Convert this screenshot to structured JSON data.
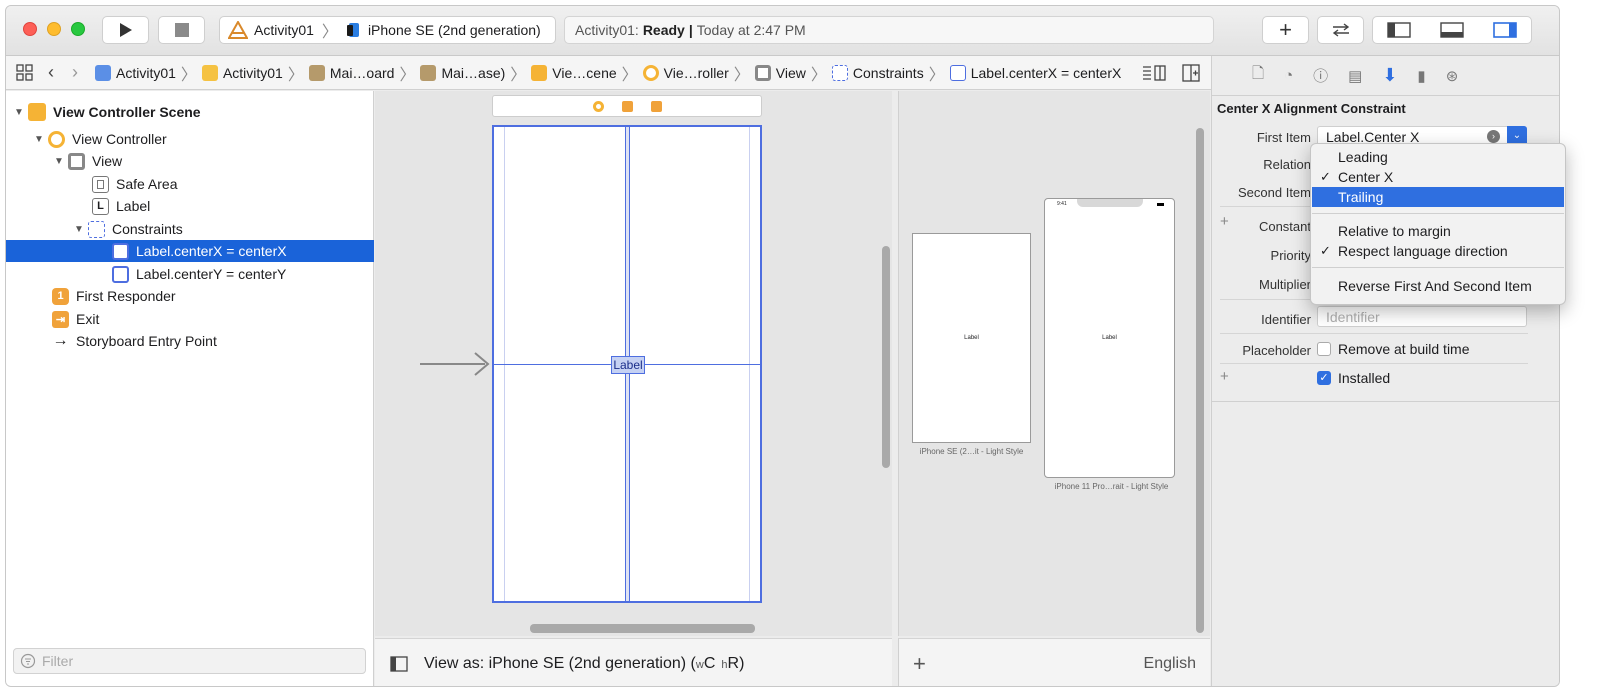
{
  "toolbar": {
    "scheme_target": "Activity01",
    "scheme_device": "iPhone SE (2nd generation)",
    "activity_prefix": "Activity01:",
    "activity_status": "Ready",
    "activity_sep": "|",
    "activity_time": "Today at 2:47 PM"
  },
  "jumpbar": [
    "Activity01",
    "Activity01",
    "Mai…oard",
    "Mai…ase)",
    "Vie…cene",
    "Vie…roller",
    "View",
    "Constraints",
    "Label.centerX = centerX"
  ],
  "navigator": {
    "items": [
      {
        "label": "View Controller Scene"
      },
      {
        "label": "View Controller"
      },
      {
        "label": "View"
      },
      {
        "label": "Safe Area"
      },
      {
        "label": "Label"
      },
      {
        "label": "Constraints"
      },
      {
        "label": "Label.centerX = centerX"
      },
      {
        "label": "Label.centerY = centerY"
      },
      {
        "label": "First Responder"
      },
      {
        "label": "Exit"
      },
      {
        "label": "Storyboard Entry Point"
      }
    ],
    "filter_placeholder": "Filter"
  },
  "canvas": {
    "label_text": "Label",
    "view_as_prefix": "View as: iPhone SE (2nd generation) (",
    "size_w": "w",
    "size_c": "C",
    "size_h": "h",
    "size_r": "R",
    "view_as_suffix": ")"
  },
  "preview": {
    "device1_label": "Label",
    "device1_caption": "iPhone SE (2…it - Light Style",
    "device2_time": "9:41",
    "device2_label": "Label",
    "device2_caption": "iPhone 11 Pro…rait - Light Style",
    "language": "English"
  },
  "inspector": {
    "title": "Center X Alignment Constraint",
    "first_item_label": "First Item",
    "first_item_value": "Label.Center X",
    "relation_label": "Relation",
    "second_item_label": "Second Item",
    "constant_label": "Constant",
    "priority_label": "Priority",
    "multiplier_label": "Multiplier",
    "identifier_label": "Identifier",
    "identifier_placeholder": "Identifier",
    "placeholder_label": "Placeholder",
    "remove_at_build": "Remove at build time",
    "installed_label": "Installed"
  },
  "dropdown": {
    "items": [
      "Leading",
      "Center X",
      "Trailing",
      "Relative to margin",
      "Respect language direction",
      "Reverse First And Second Item"
    ],
    "checked": [
      "Center X",
      "Respect language direction"
    ],
    "highlighted": "Trailing",
    "check_glyph": "✓"
  },
  "colors": {
    "selection": "#1a63d9",
    "constraint_blue": "#4e6ee0",
    "accent": "#2f6fe0"
  }
}
